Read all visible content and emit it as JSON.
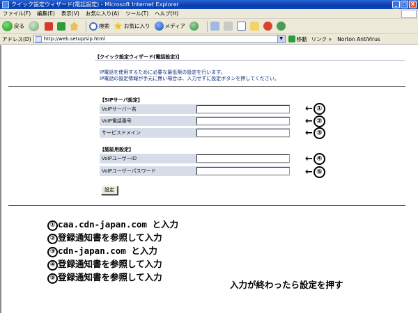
{
  "window": {
    "title": "クイック設定ウィザード(電話設定) - Microsoft Internet Explorer",
    "buttons": [
      "_",
      "□",
      "X"
    ]
  },
  "menu": [
    "ファイル(F)",
    "編集(E)",
    "表示(V)",
    "お気に入り(A)",
    "ツール(T)",
    "ヘルプ(H)"
  ],
  "toolbar": {
    "back": "戻る",
    "search": "検索",
    "favorites": "お気に入り",
    "media": "メディア"
  },
  "address": {
    "label": "アドレス(D)",
    "url": "http://web.setup/sip.html",
    "go": "移動",
    "links": "リンク »",
    "norton": "Norton AntiVirus"
  },
  "page": {
    "title": "【クイック設定ウィザード(電話設定)】",
    "intro_line1": "IP電話を使用するために必要な最低限の設定を行います。",
    "intro_line2": "IP電話の設定情報が手元に無い場合は、入力せずに設定ボタンを押してください。",
    "sip_section": "【SIPサーバ設定】",
    "auth_section": "【認証用設定】",
    "fields": [
      {
        "label": "VoIPサーバー名",
        "value": ""
      },
      {
        "label": "VoIP電話番号",
        "value": ""
      },
      {
        "label": "サービスドメイン",
        "value": ""
      },
      {
        "label": "VoIPユーザーID",
        "value": ""
      },
      {
        "label": "VoIPユーザーパスワード",
        "value": ""
      }
    ],
    "submit_label": "設定"
  },
  "markers": [
    "①",
    "②",
    "③",
    "④",
    "⑤"
  ],
  "arrow": "←",
  "instructions": [
    {
      "num": "①",
      "text": "caa.cdn-japan.com と入力"
    },
    {
      "num": "②",
      "text": "登録通知書を参照して入力"
    },
    {
      "num": "③",
      "text": "cdn-japan.com と入力"
    },
    {
      "num": "④",
      "text": "登録通知書を参照して入力"
    },
    {
      "num": "⑤",
      "text": "登録通知書を参照して入力"
    }
  ],
  "final_note": "入力が終わったら設定を押す"
}
